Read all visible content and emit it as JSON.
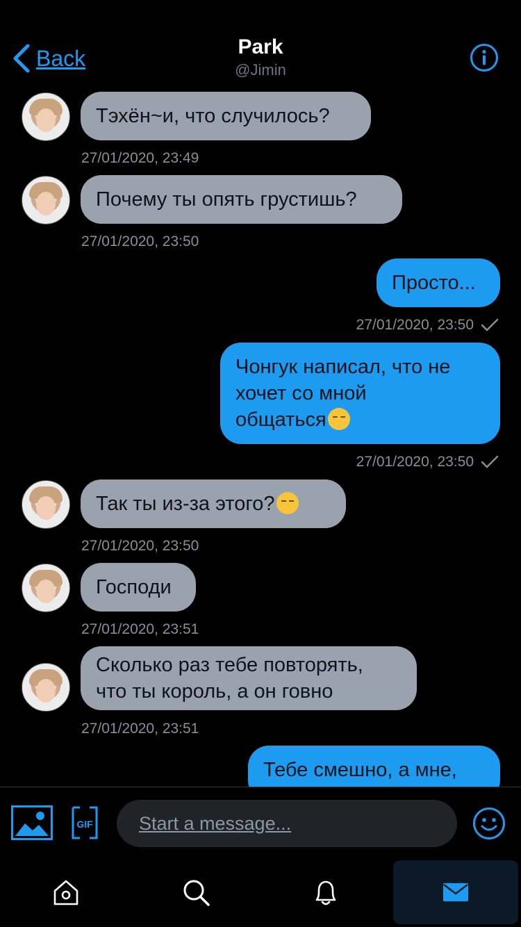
{
  "header": {
    "back_label": "Back",
    "title": "Park",
    "username": "@Jimin"
  },
  "messages": [
    {
      "direction": "in",
      "text": "Тэхён~и, что случилось?",
      "time": "27/01/2020, 23:49"
    },
    {
      "direction": "in",
      "text": "Почему ты опять грустишь?",
      "time": "27/01/2020, 23:50"
    },
    {
      "direction": "out",
      "text": "Просто...",
      "time": "27/01/2020, 23:50"
    },
    {
      "direction": "out",
      "text_lines": [
        "Чонгук написал, что не",
        "хочет со мной",
        "общаться"
      ],
      "emoji": "pensive-face-emoji",
      "time": "27/01/2020, 23:50"
    },
    {
      "direction": "in",
      "text": "Так ты из-за этого?",
      "emoji": "raised-eyebrow-emoji",
      "time": "27/01/2020, 23:50"
    },
    {
      "direction": "in",
      "text": "Господи",
      "time": "27/01/2020, 23:51"
    },
    {
      "direction": "in",
      "text_lines": [
        "Сколько раз тебе повторять,",
        "что ты король, а он говно"
      ],
      "time": "27/01/2020, 23:51"
    },
    {
      "direction": "out",
      "text": "Тебе смешно, а мне,"
    }
  ],
  "composer": {
    "placeholder": "Start a message...",
    "gif_label": "GIF"
  },
  "tabs": [
    {
      "name": "home",
      "icon": "home-icon",
      "active": false
    },
    {
      "name": "search",
      "icon": "search-icon",
      "active": false
    },
    {
      "name": "notifications",
      "icon": "bell-icon",
      "active": false
    },
    {
      "name": "messages",
      "icon": "mail-icon",
      "active": true
    }
  ],
  "colors": {
    "accent": "#1d9bf0",
    "incoming_bubble": "#9aa2ad",
    "background": "#000000",
    "timestamp": "#8a8f95"
  }
}
